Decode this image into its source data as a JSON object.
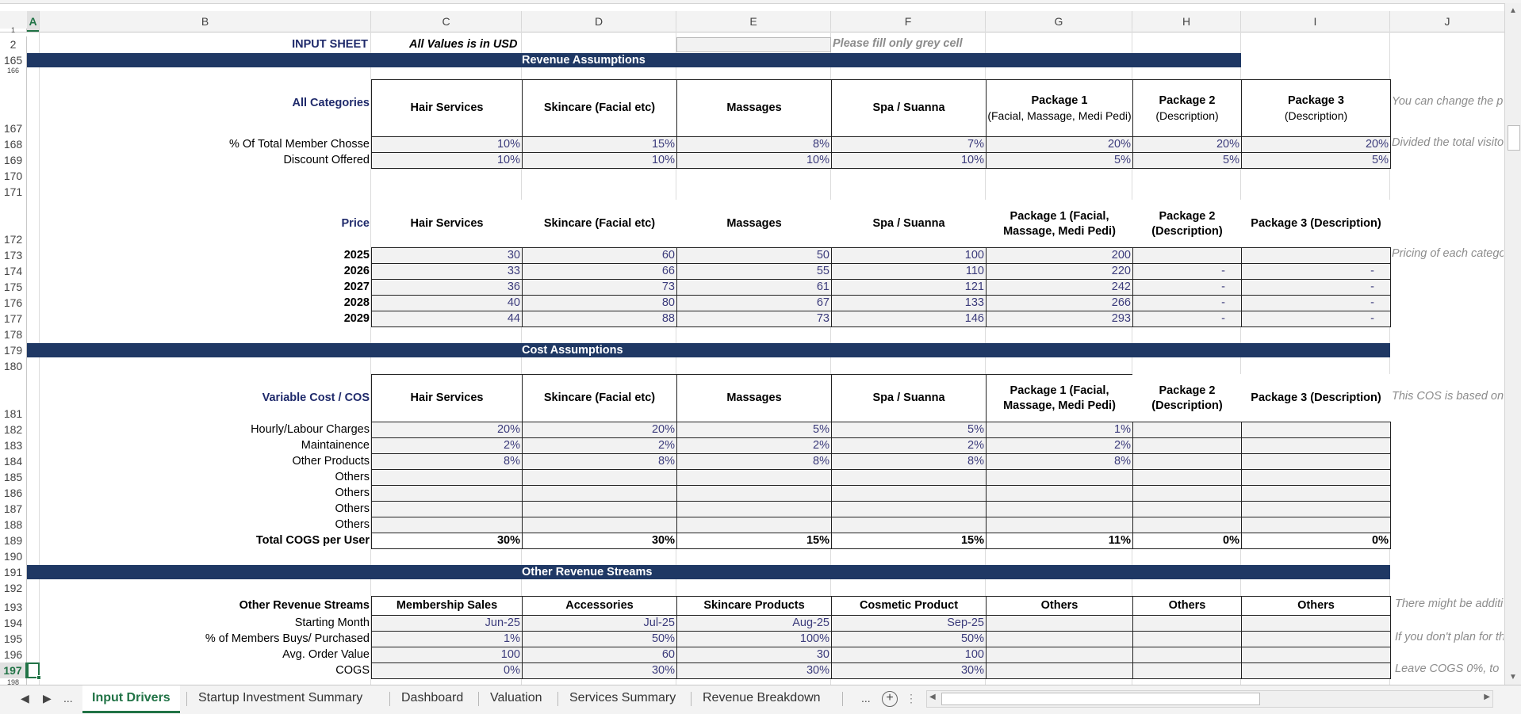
{
  "sheet": {
    "columns": [
      "A",
      "B",
      "C",
      "D",
      "E",
      "F",
      "G",
      "H",
      "I",
      "J"
    ],
    "selected_column": "A",
    "selected_row": "197",
    "top_rows": [
      "1",
      "2"
    ],
    "input_title": "INPUT SHEET",
    "currency_note": "All Values is in USD",
    "fill_note": "Please fill only grey cell"
  },
  "revenue": {
    "band_title": "Revenue Assumptions",
    "categories_label": "All Categories",
    "headers": [
      {
        "l1": "Hair Services",
        "l2": ""
      },
      {
        "l1": "Skincare (Facial etc)",
        "l2": ""
      },
      {
        "l1": "Massages",
        "l2": ""
      },
      {
        "l1": "Spa / Suanna",
        "l2": ""
      },
      {
        "l1": "Package 1",
        "l2": "(Facial, Massage, Medi Pedi)"
      },
      {
        "l1": "Package 2",
        "l2": "(Description)"
      },
      {
        "l1": "Package 3",
        "l2": "(Description)"
      }
    ],
    "header_note": "You can change the p",
    "rows": [
      {
        "label": "% Of Total Member Chosse",
        "values": [
          "10%",
          "15%",
          "8%",
          "7%",
          "20%",
          "20%",
          "20%"
        ],
        "note": "Divided the total visito"
      },
      {
        "label": "Discount Offered",
        "values": [
          "10%",
          "10%",
          "10%",
          "10%",
          "5%",
          "5%",
          "5%"
        ],
        "note": ""
      }
    ]
  },
  "price": {
    "label": "Price",
    "headers": [
      "Hair Services",
      "Skincare (Facial etc)",
      "Massages",
      "Spa / Suanna",
      "Package 1 (Facial, Massage, Medi Pedi)",
      "Package 2 (Description)",
      "Package 3 (Description)"
    ],
    "note": "Pricing of each catego",
    "rows": [
      {
        "year": "2025",
        "values": [
          "30",
          "60",
          "50",
          "100",
          "200",
          "",
          ""
        ]
      },
      {
        "year": "2026",
        "values": [
          "33",
          "66",
          "55",
          "110",
          "220",
          "-",
          "-"
        ]
      },
      {
        "year": "2027",
        "values": [
          "36",
          "73",
          "61",
          "121",
          "242",
          "-",
          "-"
        ]
      },
      {
        "year": "2028",
        "values": [
          "40",
          "80",
          "67",
          "133",
          "266",
          "-",
          "-"
        ]
      },
      {
        "year": "2029",
        "values": [
          "44",
          "88",
          "73",
          "146",
          "293",
          "-",
          "-"
        ]
      }
    ]
  },
  "cost": {
    "band_title": "Cost Assumptions",
    "label": "Variable Cost / COS",
    "note": "This COS is based on",
    "rows": [
      {
        "label": "Hourly/Labour Charges",
        "values": [
          "20%",
          "20%",
          "5%",
          "5%",
          "1%",
          "",
          ""
        ]
      },
      {
        "label": "Maintainence",
        "values": [
          "2%",
          "2%",
          "2%",
          "2%",
          "2%",
          "",
          ""
        ]
      },
      {
        "label": "Other Products",
        "values": [
          "8%",
          "8%",
          "8%",
          "8%",
          "8%",
          "",
          ""
        ]
      },
      {
        "label": "Others",
        "values": [
          "",
          "",
          "",
          "",
          "",
          "",
          ""
        ]
      },
      {
        "label": "Others",
        "values": [
          "",
          "",
          "",
          "",
          "",
          "",
          ""
        ]
      },
      {
        "label": "Others",
        "values": [
          "",
          "",
          "",
          "",
          "",
          "",
          ""
        ]
      },
      {
        "label": "Others",
        "values": [
          "",
          "",
          "",
          "",
          "",
          "",
          ""
        ]
      }
    ],
    "total": {
      "label": "Total COGS per User",
      "values": [
        "30%",
        "30%",
        "15%",
        "15%",
        "11%",
        "0%",
        "0%"
      ]
    }
  },
  "other": {
    "band_title": "Other Revenue Streams",
    "label": "Other Revenue Streams",
    "headers": [
      "Membership Sales",
      "Accessories",
      "Skincare Products",
      "Cosmetic Product",
      "Others",
      "Others",
      "Others"
    ],
    "header_note": "There might be additi",
    "rows": [
      {
        "label": "Starting Month",
        "values": [
          "Jun-25",
          "Jul-25",
          "Aug-25",
          "Sep-25",
          "",
          "",
          ""
        ],
        "note": ""
      },
      {
        "label": "% of Members Buys/ Purchased",
        "values": [
          "1%",
          "50%",
          "100%",
          "50%",
          "",
          "",
          ""
        ],
        "note": "If you don't plan for th"
      },
      {
        "label": "Avg. Order Value",
        "values": [
          "100",
          "60",
          "30",
          "100",
          "",
          "",
          ""
        ],
        "note": ""
      },
      {
        "label": "COGS",
        "values": [
          "0%",
          "30%",
          "30%",
          "30%",
          "",
          "",
          ""
        ],
        "note": "Leave COGS 0%, to"
      }
    ]
  },
  "row_numbers": [
    "165",
    "166",
    "167",
    "168",
    "169",
    "170",
    "171",
    "172",
    "173",
    "174",
    "175",
    "176",
    "177",
    "178",
    "179",
    "180",
    "181",
    "182",
    "183",
    "184",
    "185",
    "186",
    "187",
    "188",
    "189",
    "190",
    "191",
    "192",
    "193",
    "194",
    "195",
    "196",
    "197",
    "198"
  ],
  "tabs": [
    "Input Drivers",
    "Startup Investment Summary",
    "Dashboard",
    "Valuation",
    "Services Summary",
    "Revenue Breakdown"
  ],
  "tab_more": "...",
  "tab_more_right": "...",
  "add_sheet_glyph": "+"
}
